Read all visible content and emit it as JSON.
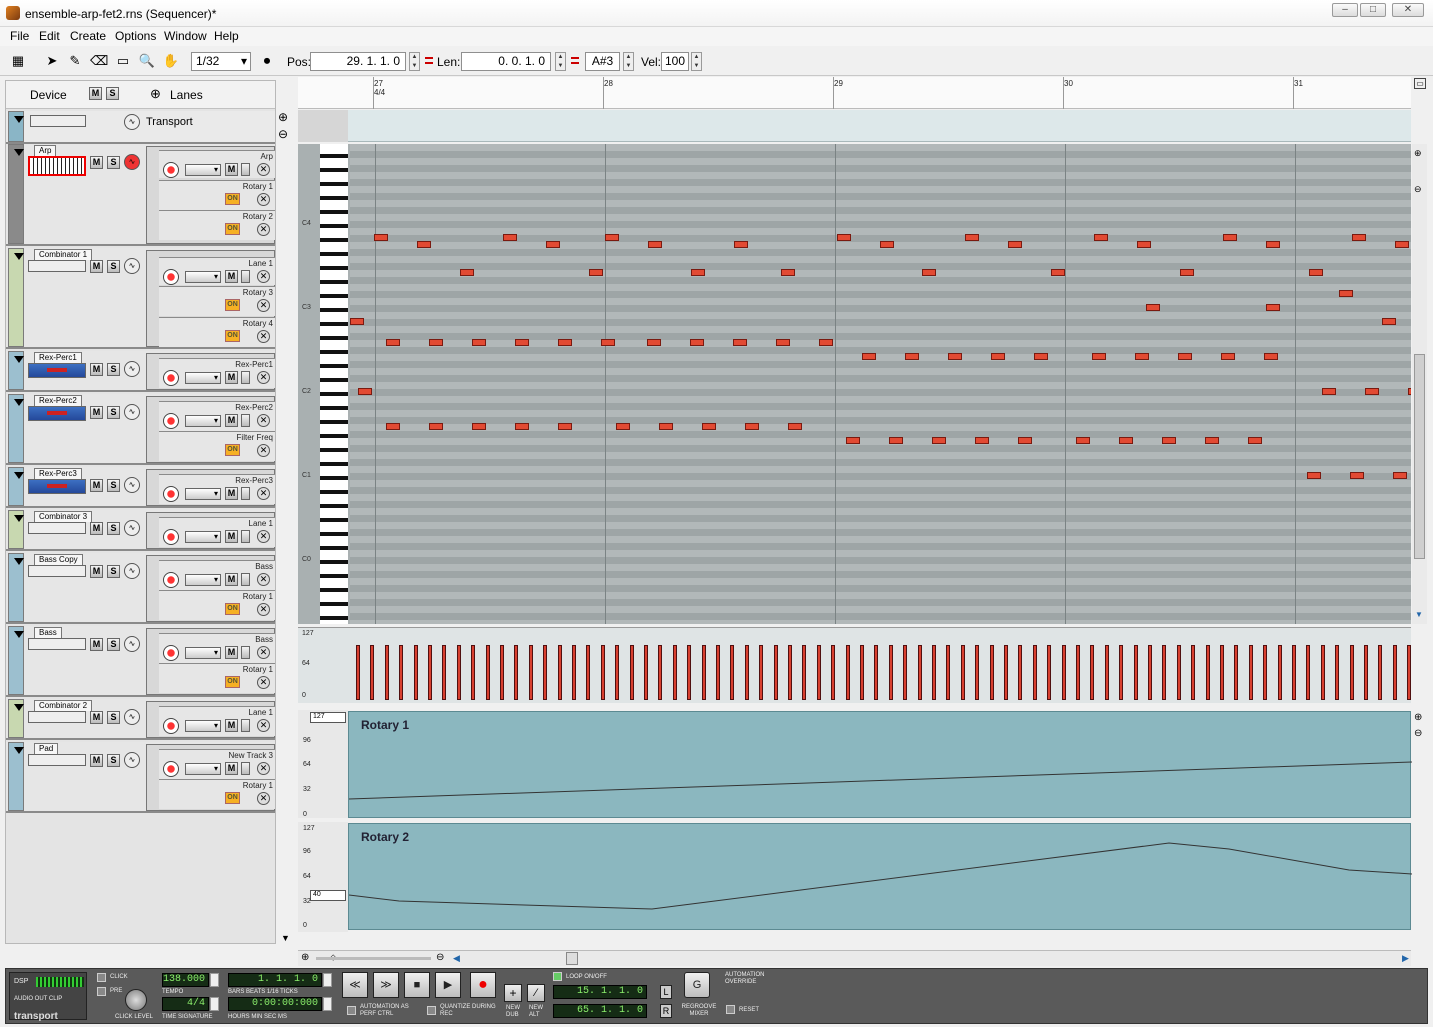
{
  "window": {
    "title": "ensemble-arp-fet2.rns (Sequencer)*"
  },
  "menu": [
    "File",
    "Edit",
    "Create",
    "Options",
    "Window",
    "Help"
  ],
  "toolbar": {
    "snap": "1/32",
    "pos_label": "Pos:",
    "pos_value": "29.  1.  1.    0",
    "len_label": "Len:",
    "len_value": "0.  0.  1.    0",
    "note_value": "A#3",
    "vel_label": "Vel:",
    "vel_value": "100"
  },
  "left_header": {
    "device": "Device",
    "m": "M",
    "s": "S",
    "lanes": "Lanes"
  },
  "transport_track": {
    "label": "Transport"
  },
  "tracks": [
    {
      "name": "Arp",
      "color": "#8a8a8a",
      "lanes": [
        "Arp",
        "Rotary 1",
        "Rotary 2"
      ]
    },
    {
      "name": "Combinator 1",
      "color": "#c8d8b0",
      "lanes": [
        "Lane 1",
        "Rotary 3",
        "Rotary 4"
      ]
    },
    {
      "name": "Rex-Perc1",
      "color": "#9cbfcf",
      "lanes": [
        "Rex-Perc1"
      ]
    },
    {
      "name": "Rex-Perc2",
      "color": "#9cbfcf",
      "lanes": [
        "Rex-Perc2",
        "Filter Freq"
      ]
    },
    {
      "name": "Rex-Perc3",
      "color": "#9cbfcf",
      "lanes": [
        "Rex-Perc3"
      ]
    },
    {
      "name": "Combinator 3",
      "color": "#c8d8b0",
      "lanes": [
        "Lane 1"
      ]
    },
    {
      "name": "Bass Copy",
      "color": "#9cbfcf",
      "lanes": [
        "Bass",
        "Rotary 1"
      ]
    },
    {
      "name": "Bass",
      "color": "#9cbfcf",
      "lanes": [
        "Bass",
        "Rotary 1"
      ]
    },
    {
      "name": "Combinator 2",
      "color": "#c8d8b0",
      "lanes": [
        "Lane 1"
      ]
    },
    {
      "name": "Pad",
      "color": "#9cbfcf",
      "lanes": [
        "New Track 3",
        "Rotary 1"
      ]
    }
  ],
  "ruler": {
    "bars": [
      "27",
      "28",
      "29",
      "30",
      "31"
    ],
    "signature": "4/4"
  },
  "keyboard": {
    "octaves": [
      "C4",
      "C3",
      "C2",
      "C1",
      "C0"
    ]
  },
  "velocity": {
    "ticks": [
      "127",
      "64",
      "0"
    ]
  },
  "automation": [
    {
      "name": "Rotary 1",
      "ticks": [
        "127",
        "96",
        "64",
        "32",
        "0"
      ],
      "value_box": "127"
    },
    {
      "name": "Rotary 2",
      "ticks": [
        "127",
        "96",
        "64",
        "32",
        "0"
      ],
      "value_box": "40"
    }
  ],
  "transport": {
    "dsp": "DSP",
    "audio_out_clip": "AUDIO OUT CLIP",
    "brand": "transport",
    "click": "CLICK",
    "pre": "PRE",
    "click_level": "CLICK LEVEL",
    "tempo": "138.000",
    "tempo_label": "TEMPO",
    "time_signature": "4/4",
    "time_signature_label": "TIME SIGNATURE",
    "position": "1.  1.  1.    0",
    "position_label": "BARS  BEATS 1/16  TICKS",
    "time": "0:00:00:000",
    "time_label": "HOURS   MIN   SEC     MS",
    "automation_as_perf": "AUTOMATION AS PERF CTRL",
    "quantize_during_rec": "QUANTIZE DURING REC",
    "new_dub": "NEW DUB",
    "new_alt": "NEW ALT",
    "loop_on_off": "LOOP ON/OFF",
    "loop_left": "15.  1.  1.    0",
    "loop_right": "65.  1.  1.    0",
    "L": "L",
    "R": "R",
    "regroove": "REGROOVE MIXER",
    "automation_override": "AUTOMATION OVERRIDE",
    "reset": "RESET"
  },
  "colors": {
    "note": "#e24a33",
    "automation_lane": "#8bb7bf",
    "lcd": "#8cf06c"
  }
}
